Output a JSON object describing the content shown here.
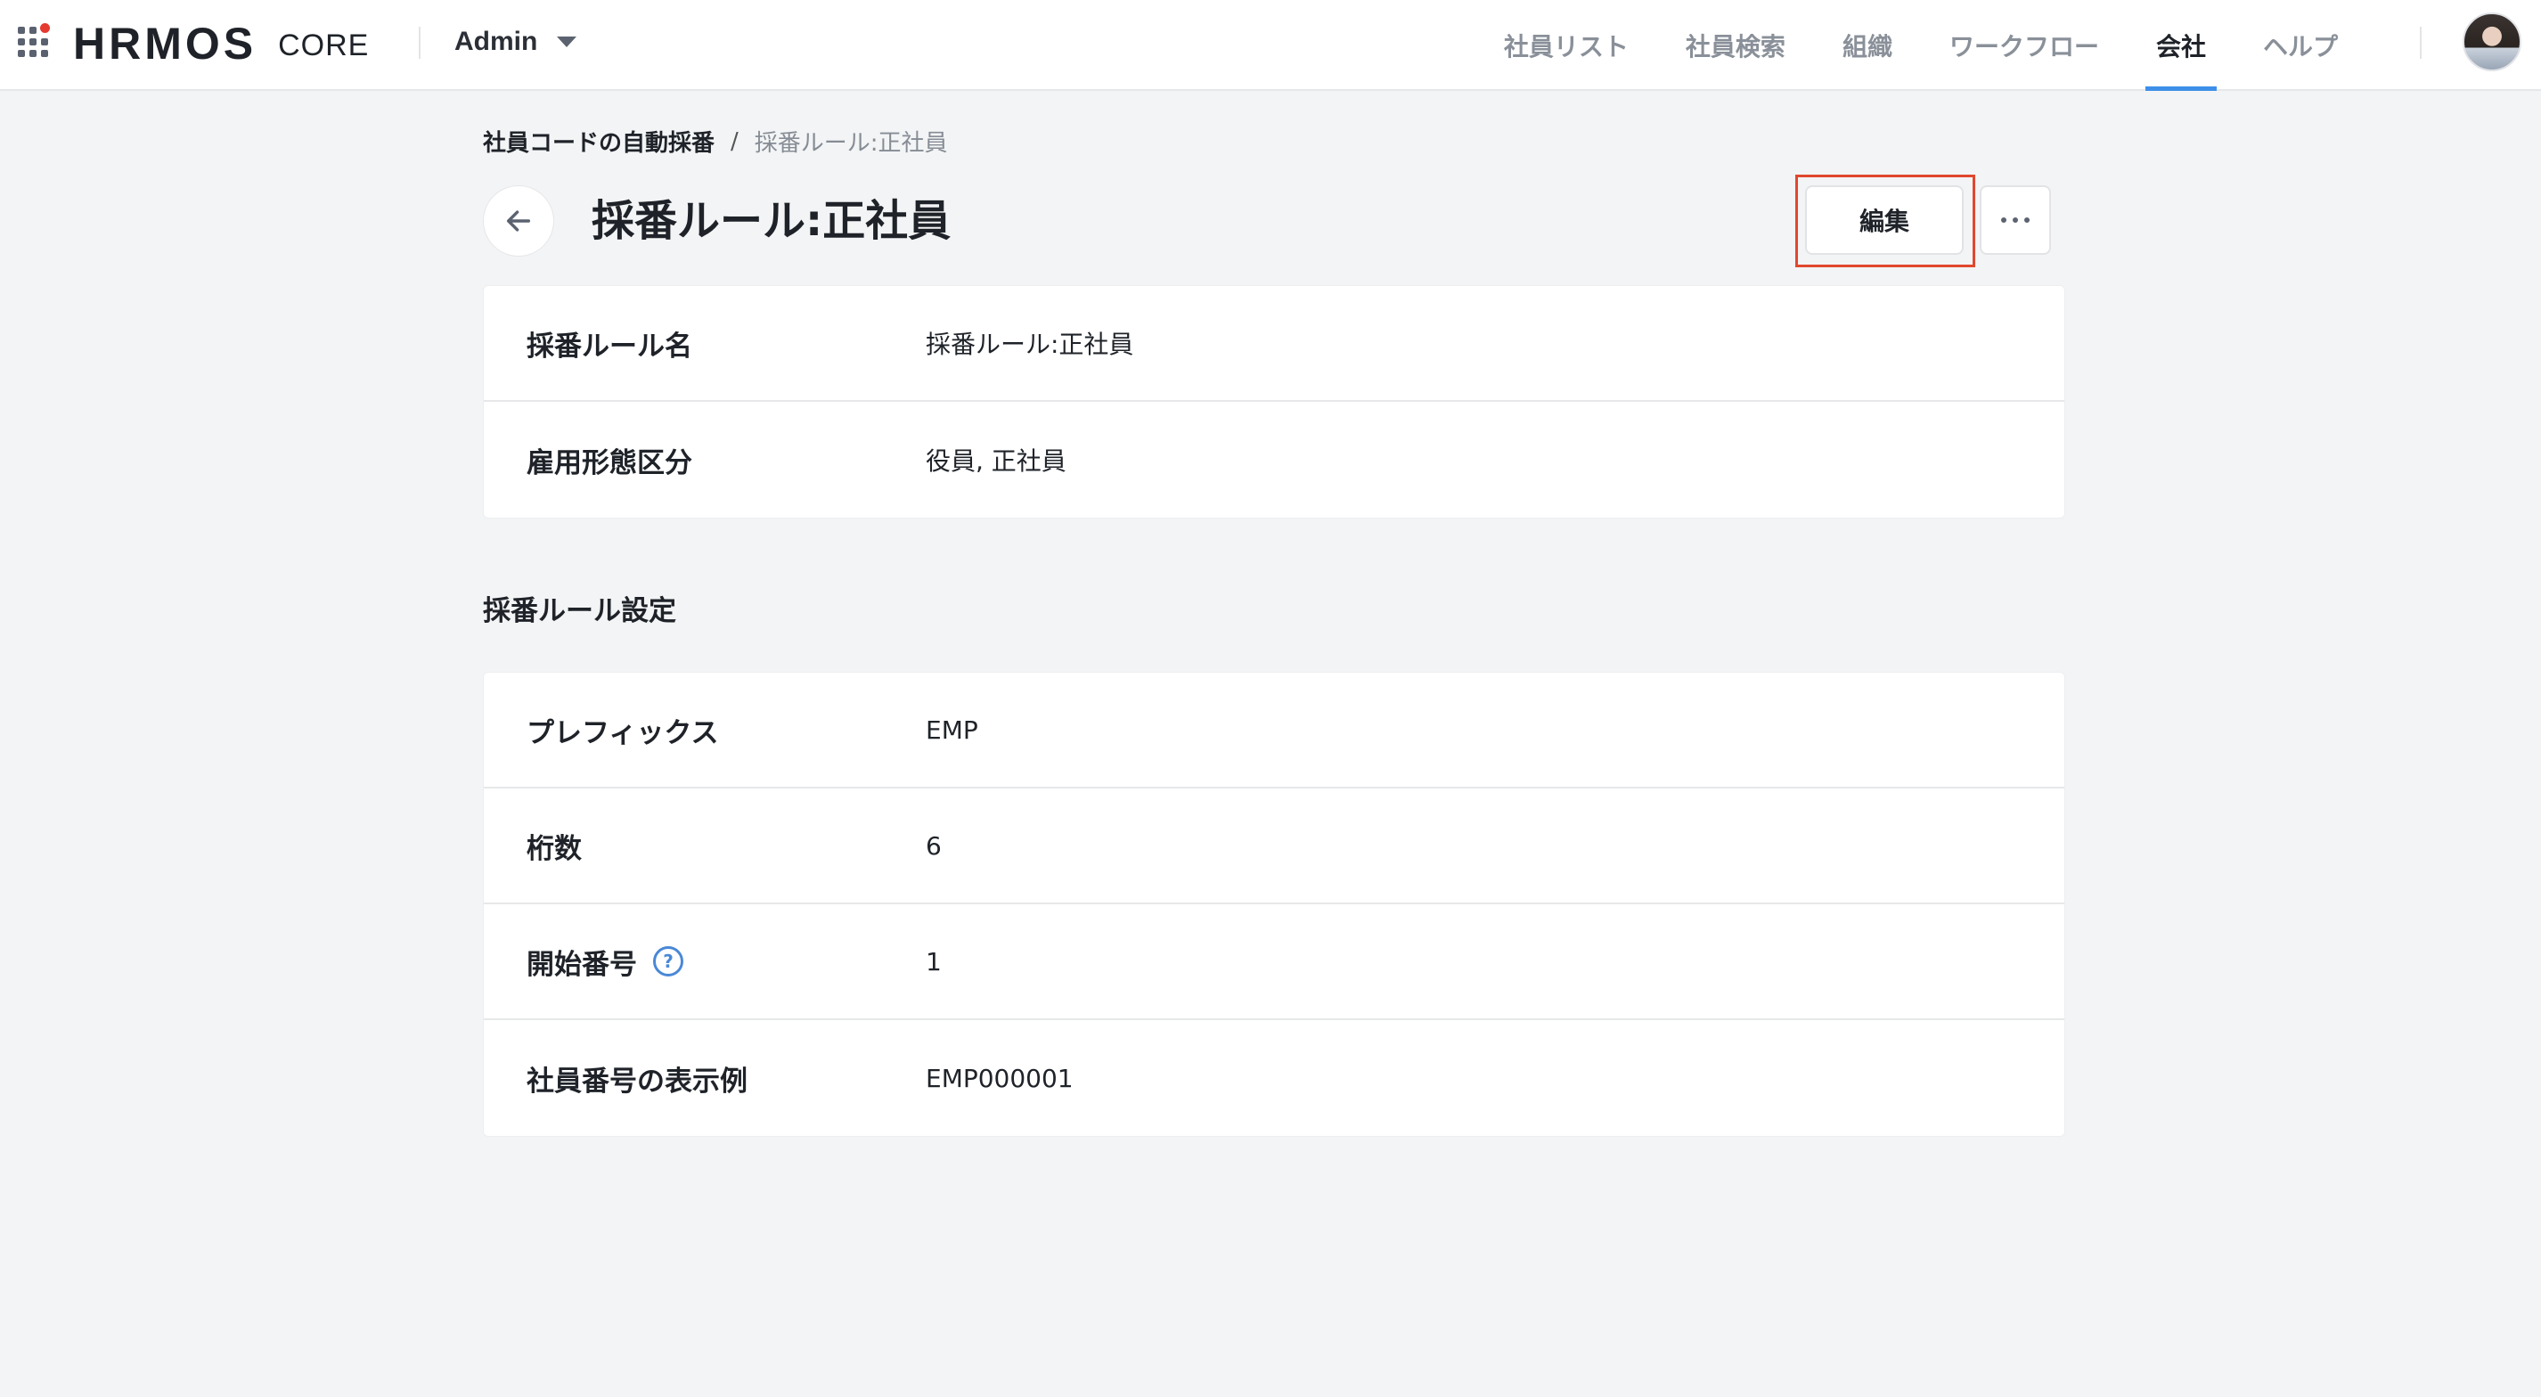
{
  "header": {
    "logo_text": "HRMOS",
    "logo_sub": "CORE",
    "role": "Admin",
    "nav": [
      {
        "label": "社員リスト",
        "active": false
      },
      {
        "label": "社員検索",
        "active": false
      },
      {
        "label": "組織",
        "active": false
      },
      {
        "label": "ワークフロー",
        "active": false
      },
      {
        "label": "会社",
        "active": true
      },
      {
        "label": "ヘルプ",
        "active": false
      }
    ],
    "accent_color": "#3d8fe8"
  },
  "breadcrumb": {
    "parent": "社員コードの自動採番",
    "separator": "/",
    "current": "採番ルール:正社員"
  },
  "page": {
    "title": "採番ルール:正社員",
    "edit_label": "編集"
  },
  "basic_info": [
    {
      "label": "採番ルール名",
      "value": "採番ルール:正社員"
    },
    {
      "label": "雇用形態区分",
      "value": "役員, 正社員"
    }
  ],
  "settings": {
    "title": "採番ルール設定",
    "rows": [
      {
        "label": "プレフィックス",
        "value": "EMP"
      },
      {
        "label": "桁数",
        "value": "6"
      },
      {
        "label": "開始番号",
        "value": "1",
        "help_glyph": "?"
      },
      {
        "label": "社員番号の表示例",
        "value": "EMP000001"
      }
    ]
  }
}
